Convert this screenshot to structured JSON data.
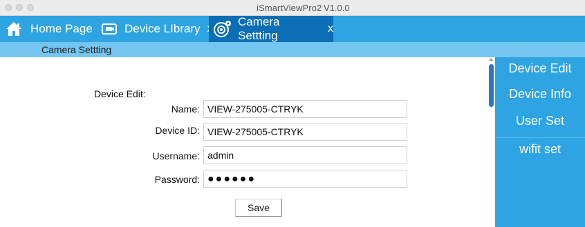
{
  "window": {
    "title": "iSmartViewPro2",
    "version": "V1.0.0"
  },
  "tabs": [
    {
      "label": "Home Page",
      "icon": "home-icon",
      "closable": false
    },
    {
      "label": "Device LIbrary",
      "icon": "device-library-icon",
      "closable": true,
      "close_label": "x"
    },
    {
      "label": "Camera Settting",
      "icon": "camera-settings-icon",
      "closable": true,
      "close_label": "x",
      "active": true
    }
  ],
  "breadcrumb": "Camera Settting",
  "form": {
    "section_label": "Device Edit:",
    "fields": [
      {
        "label": "Name:",
        "value": "VIEW-275005-CTRYK"
      },
      {
        "label": "Device ID:",
        "value": "VIEW-275005-CTRYK"
      },
      {
        "label": "Username:",
        "value": "admin"
      },
      {
        "label": "Password:",
        "value": "●●●●●●"
      }
    ],
    "save_label": "Save"
  },
  "side_menu": {
    "items": [
      {
        "label": "Device Edit"
      },
      {
        "label": "Device Info"
      },
      {
        "label": "User Set"
      },
      {
        "label": "wifit set"
      }
    ]
  },
  "colors": {
    "tabbar": "#2ea4e2",
    "active_tab": "#0c6eb4",
    "breadcrumb_bar": "#74c5ef",
    "side_menu": "#2ea4e2",
    "scroll_thumb": "#2a78c2"
  }
}
